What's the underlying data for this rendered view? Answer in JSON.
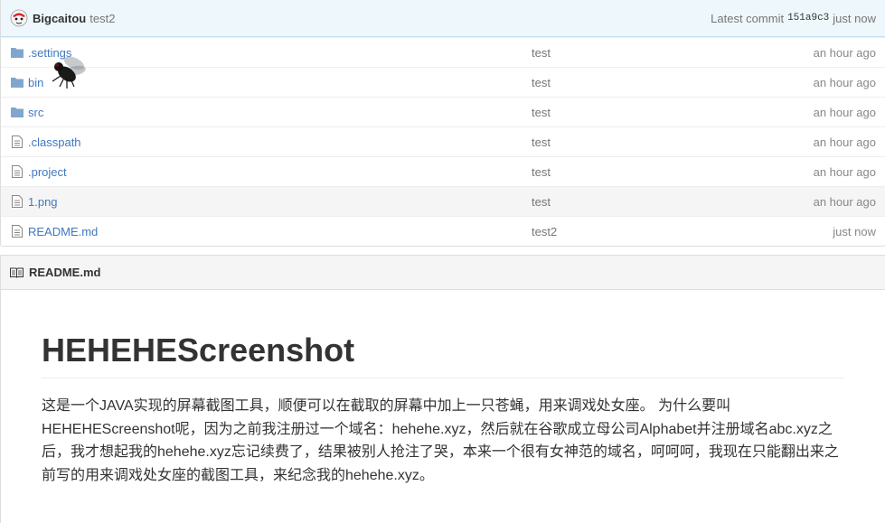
{
  "commit": {
    "author": "Bigcaitou",
    "message": "test2",
    "latest_label": "Latest commit",
    "sha": "151a9c3",
    "time": "just now"
  },
  "files": [
    {
      "type": "folder",
      "name": ".settings",
      "message": "test",
      "age": "an hour ago"
    },
    {
      "type": "folder",
      "name": "bin",
      "message": "test",
      "age": "an hour ago"
    },
    {
      "type": "folder",
      "name": "src",
      "message": "test",
      "age": "an hour ago"
    },
    {
      "type": "file",
      "name": ".classpath",
      "message": "test",
      "age": "an hour ago"
    },
    {
      "type": "file",
      "name": ".project",
      "message": "test",
      "age": "an hour ago"
    },
    {
      "type": "file",
      "name": "1.png",
      "message": "test",
      "age": "an hour ago"
    },
    {
      "type": "file",
      "name": "README.md",
      "message": "test2",
      "age": "just now"
    }
  ],
  "readme": {
    "header": "README.md",
    "title": "HEHEHEScreenshot",
    "paragraph": "这是一个JAVA实现的屏幕截图工具，顺便可以在截取的屏幕中加上一只苍蝇，用来调戏处女座。 为什么要叫HEHEHEScreenshot呢，因为之前我注册过一个域名：hehehe.xyz，然后就在谷歌成立母公司Alphabet并注册域名abc.xyz之后，我才想起我的hehehe.xyz忘记续费了，结果被别人抢注了哭，本来一个很有女神范的域名，呵呵呵，我现在只能翻出来之前写的用来调戏处女座的截图工具，来纪念我的hehehe.xyz。"
  },
  "colors": {
    "link": "#4078c0",
    "folder_icon": "#80a6cd",
    "commit_bar_bg": "#eef7fc"
  }
}
